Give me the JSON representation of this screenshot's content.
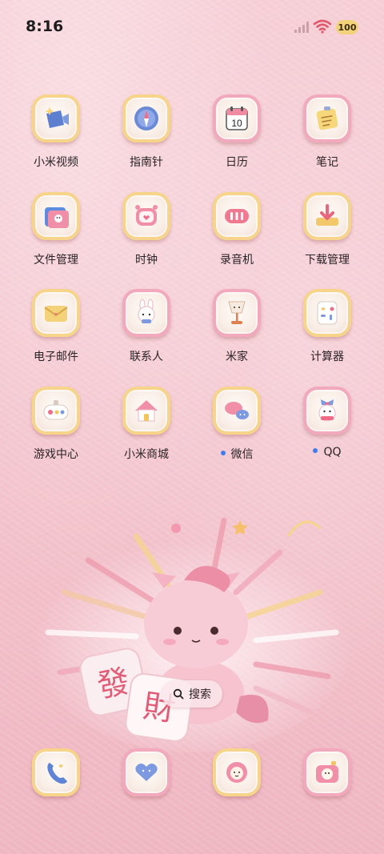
{
  "status_bar": {
    "time": "8:16",
    "battery_level": "100"
  },
  "apps": [
    {
      "label": "小米视频",
      "icon": "video-icon"
    },
    {
      "label": "指南针",
      "icon": "compass-icon"
    },
    {
      "label": "日历",
      "icon": "calendar-icon",
      "calendar_day": "10"
    },
    {
      "label": "笔记",
      "icon": "notes-icon"
    },
    {
      "label": "文件管理",
      "icon": "folder-icon"
    },
    {
      "label": "时钟",
      "icon": "alarm-clock-icon"
    },
    {
      "label": "录音机",
      "icon": "recorder-icon"
    },
    {
      "label": "下载管理",
      "icon": "download-icon"
    },
    {
      "label": "电子邮件",
      "icon": "mail-icon"
    },
    {
      "label": "联系人",
      "icon": "contacts-icon"
    },
    {
      "label": "米家",
      "icon": "lamp-icon"
    },
    {
      "label": "计算器",
      "icon": "calculator-icon"
    },
    {
      "label": "游戏中心",
      "icon": "gamepad-icon"
    },
    {
      "label": "小米商城",
      "icon": "house-icon"
    },
    {
      "label": "微信",
      "icon": "chat-bubbles-icon",
      "new_dot": true
    },
    {
      "label": "QQ",
      "icon": "penguin-icon",
      "new_dot": true
    }
  ],
  "search": {
    "label": "搜索"
  },
  "art": {
    "characters": [
      "發",
      "財"
    ]
  },
  "dock": [
    {
      "icon": "phone-icon"
    },
    {
      "icon": "message-bubble-icon"
    },
    {
      "icon": "browser-lion-icon"
    },
    {
      "icon": "camera-icon"
    }
  ],
  "colors": {
    "accent_dot": "#3d7cf0",
    "frame_yellow": "#f6d58a",
    "frame_pink": "#f2a9bd"
  }
}
